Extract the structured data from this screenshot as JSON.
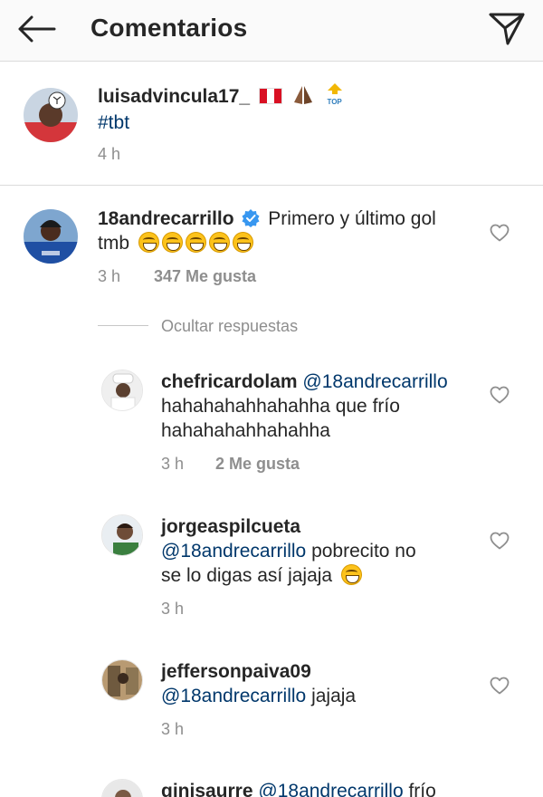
{
  "header": {
    "title": "Comentarios"
  },
  "caption": {
    "username": "luisadvincula17_",
    "text": "#tbt",
    "time": "4 h",
    "badge": "TOP"
  },
  "comment": {
    "username": "18andrecarrillo",
    "text": "Primero y último gol",
    "text2": "tmb",
    "time": "3 h",
    "likes": "347 Me gusta"
  },
  "replies_toggle": "Ocultar respuestas",
  "replies": [
    {
      "username": "chefricardolam",
      "mention": "@18andrecarrillo",
      "line1": "hahahahahhahahha que frío",
      "line2": "hahahahahhahahha",
      "time": "3 h",
      "likes": "2 Me gusta"
    },
    {
      "username": "jorgeaspilcueta",
      "mention": "@18andrecarrillo",
      "line1": "pobrecito no",
      "line2": "se lo digas así jajaja",
      "time": "3 h"
    },
    {
      "username": "jeffersonpaiva09",
      "mention": "@18andrecarrillo",
      "line1": "jajaja",
      "time": "3 h"
    },
    {
      "username": "ginisaurre",
      "mention": "@18andrecarrillo",
      "line1": "frío"
    }
  ]
}
